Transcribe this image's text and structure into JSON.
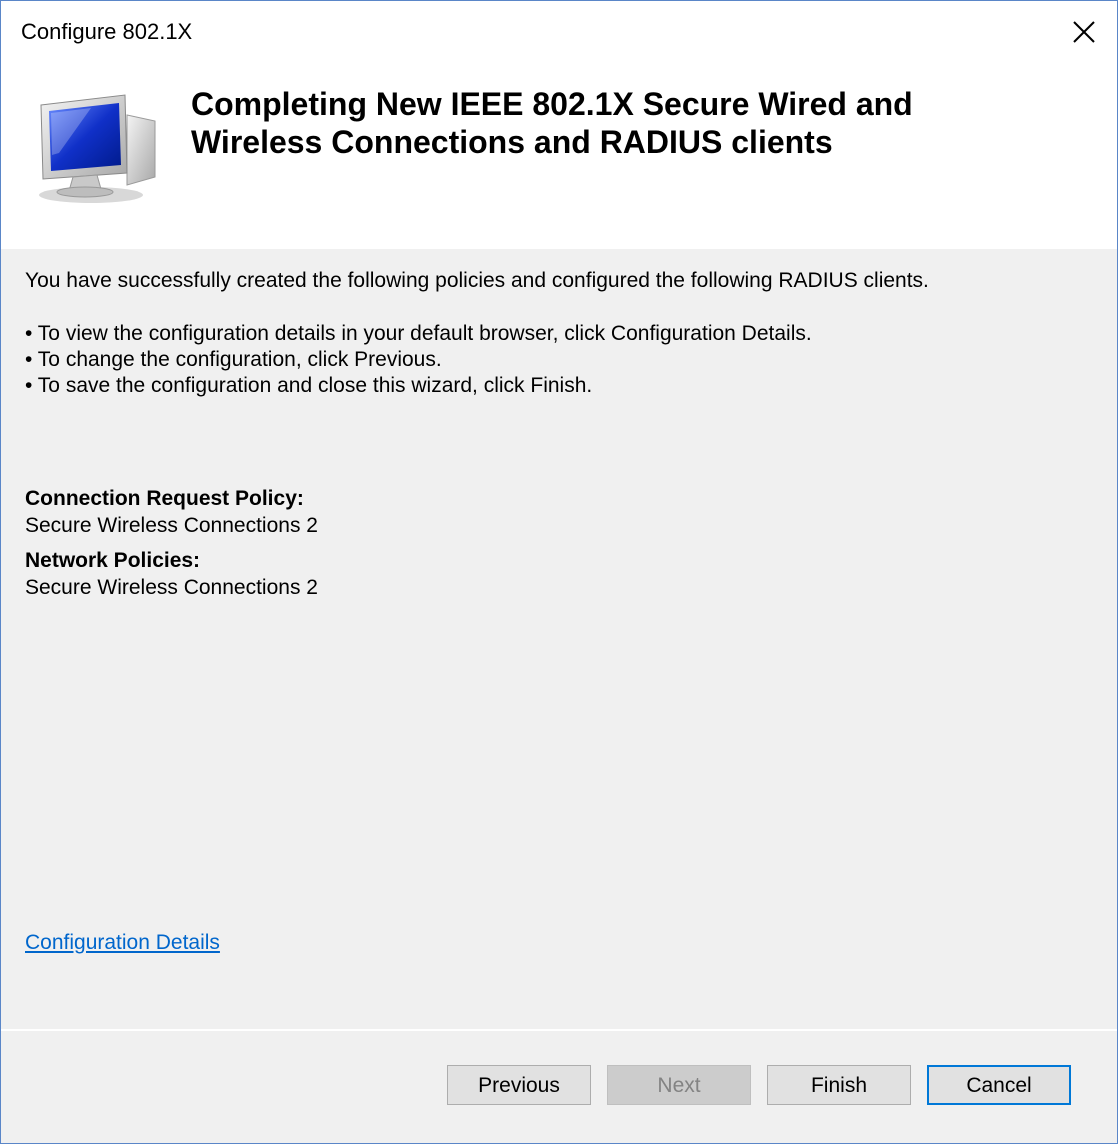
{
  "window": {
    "title": "Configure 802.1X"
  },
  "header": {
    "title_line1": "Completing New IEEE 802.1X Secure Wired and",
    "title_line2": "Wireless Connections and RADIUS clients"
  },
  "content": {
    "intro": "You have successfully created the following policies and configured the following RADIUS clients.",
    "bullets": [
      "• To view the configuration details in your default browser, click Configuration Details.",
      "• To change the configuration, click Previous.",
      "• To save the configuration and close this wizard, click Finish."
    ],
    "connection_request_policy_label": "Connection Request Policy:",
    "connection_request_policy_value": "Secure Wireless Connections 2",
    "network_policies_label": "Network Policies:",
    "network_policies_value": "Secure Wireless Connections 2",
    "details_link": "Configuration Details"
  },
  "buttons": {
    "previous": "Previous",
    "next": "Next",
    "finish": "Finish",
    "cancel": "Cancel"
  },
  "colors": {
    "link": "#0066cc",
    "default_button_border": "#0078d7",
    "window_border": "#5a86c8"
  },
  "icons": {
    "close": "close-icon",
    "header": "computer-monitor-icon"
  }
}
